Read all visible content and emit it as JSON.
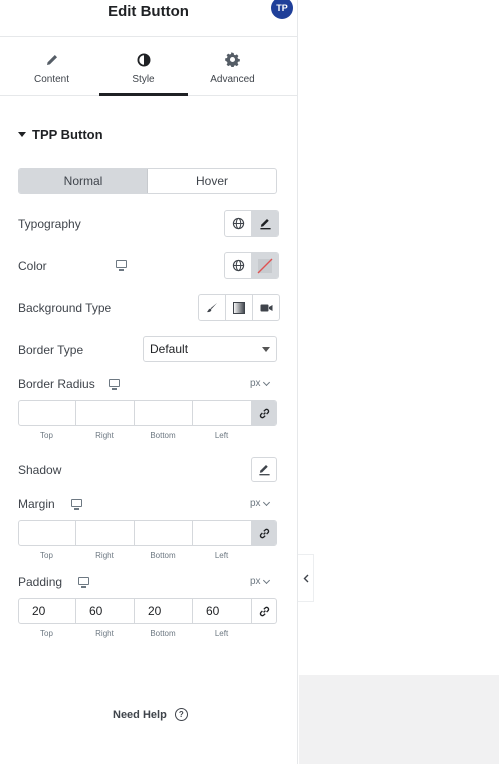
{
  "panel": {
    "title": "Edit Button",
    "badge": "TP",
    "tabs": [
      {
        "label": "Content",
        "icon": "pencil-icon"
      },
      {
        "label": "Style",
        "icon": "contrast-icon",
        "active": true
      },
      {
        "label": "Advanced",
        "icon": "gear-icon"
      }
    ]
  },
  "section": {
    "title": "TPP Button"
  },
  "state_toggle": {
    "normal": "Normal",
    "hover": "Hover",
    "selected": "Normal"
  },
  "controls": {
    "typography": {
      "label": "Typography"
    },
    "color": {
      "label": "Color"
    },
    "background_type": {
      "label": "Background Type",
      "options": [
        "classic-brush-icon",
        "gradient-icon",
        "video-icon"
      ]
    },
    "border_type": {
      "label": "Border Type",
      "value": "Default"
    },
    "border_radius": {
      "label": "Border Radius",
      "unit": "px",
      "values": {
        "top": "",
        "right": "",
        "bottom": "",
        "left": ""
      },
      "linked": true
    },
    "shadow": {
      "label": "Shadow"
    },
    "margin": {
      "label": "Margin",
      "unit": "px",
      "values": {
        "top": "",
        "right": "",
        "bottom": "",
        "left": ""
      },
      "linked": true
    },
    "padding": {
      "label": "Padding",
      "unit": "px",
      "values": {
        "top": "20",
        "right": "60",
        "bottom": "20",
        "left": "60"
      },
      "linked": false
    }
  },
  "dim_labels": {
    "top": "Top",
    "right": "Right",
    "bottom": "Bottom",
    "left": "Left"
  },
  "footer": {
    "need_help": "Need Help",
    "help_glyph": "?"
  },
  "colors": {
    "accent_badge": "#1f3f99",
    "border": "#d5d8dc",
    "selected_bg": "#d5d8dc",
    "text": "#3f444b",
    "color_unset_slash": "#e05050"
  }
}
